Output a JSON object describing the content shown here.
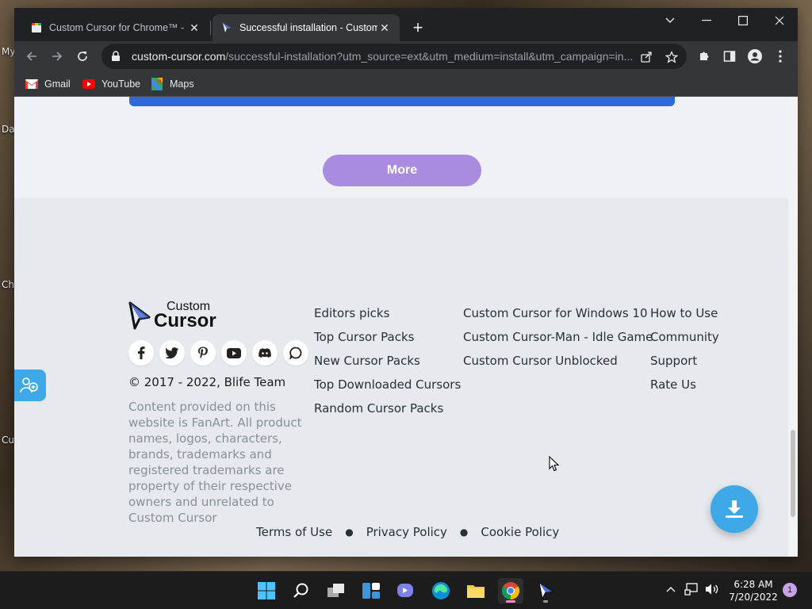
{
  "desktop": {
    "labels": [
      "My",
      "Da",
      "Ch",
      "Cu"
    ]
  },
  "browser": {
    "tabs": [
      {
        "title": "Custom Cursor for Chrome™ - Ch",
        "active": false
      },
      {
        "title": "Successful installation - Custom C",
        "active": true
      }
    ],
    "new_tab": "+",
    "url_host": "custom-cursor.com",
    "url_rest": "/successful-installation?utm_source=ext&utm_medium=install&utm_campaign=in...",
    "bookmarks": [
      {
        "label": "Gmail",
        "icon": "gmail-icon"
      },
      {
        "label": "YouTube",
        "icon": "youtube-icon"
      },
      {
        "label": "Maps",
        "icon": "maps-icon"
      }
    ]
  },
  "page": {
    "more_label": "More",
    "logo": {
      "line1": "Custom",
      "line2": "Cursor"
    },
    "socials": [
      "facebook-icon",
      "twitter-icon",
      "pinterest-icon",
      "youtube-icon",
      "discord-icon",
      "chat-icon"
    ],
    "copyright": "© 2017 - 2022, Blife Team",
    "disclaimer": "Content provided on this website is FanArt. All product names, logos, characters, brands, trademarks and registered trademarks are property of their respective owners and unrelated to Custom Cursor",
    "links_col1": [
      "Editors picks",
      "Top Cursor Packs",
      "New Cursor Packs",
      "Top Downloaded Cursors",
      "Random Cursor Packs"
    ],
    "links_col2": [
      "Custom Cursor for Windows 10",
      "Custom Cursor-Man - Idle Game",
      "Custom Cursor Unblocked"
    ],
    "links_col3": [
      "How to Use",
      "Community",
      "Support",
      "Rate Us"
    ],
    "legal": [
      "Terms of Use",
      "Privacy Policy",
      "Cookie Policy"
    ]
  },
  "taskbar": {
    "time": "6:28 AM",
    "date": "7/20/2022",
    "notifications": "1"
  },
  "colors": {
    "accent_blue": "#3ea9e6",
    "more_purple": "#a98be0",
    "strip_blue": "#2d6ad9"
  }
}
